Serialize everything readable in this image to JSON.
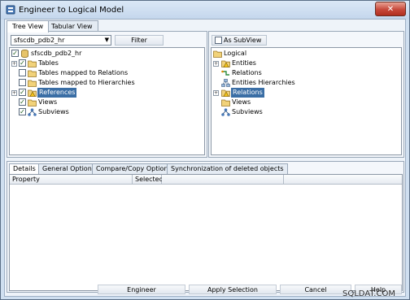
{
  "window": {
    "title": "Engineer to Logical Model",
    "close_glyph": "✕",
    "app_icon": "app-model-icon"
  },
  "top_tabs": [
    {
      "label": "Tree View",
      "active": true
    },
    {
      "label": "Tabular View",
      "active": false
    }
  ],
  "left_panel": {
    "combo_value": "sfscdb_pdb2_hr",
    "filter_button": "Filter",
    "tree": [
      {
        "label": "sfscdb_pdb2_hr",
        "checked": true,
        "icon": "database-icon",
        "expander": ""
      },
      {
        "label": "Tables",
        "checked": true,
        "icon": "folder-icon",
        "expander": "+"
      },
      {
        "label": "Tables mapped to Relations",
        "checked": false,
        "icon": "folder-icon",
        "expander": ""
      },
      {
        "label": "Tables mapped to Hierarchies",
        "checked": false,
        "icon": "folder-icon",
        "expander": ""
      },
      {
        "label": "References",
        "checked": true,
        "icon": "warning-folder-icon",
        "expander": "+",
        "selected": true
      },
      {
        "label": "Views",
        "checked": true,
        "icon": "folder-icon",
        "expander": ""
      },
      {
        "label": "Subviews",
        "checked": true,
        "icon": "subview-icon",
        "expander": ""
      }
    ]
  },
  "right_panel": {
    "subview_checkbox_label": "As SubView",
    "tree": [
      {
        "label": "Logical",
        "icon": "folder-icon",
        "expander": ""
      },
      {
        "label": "Entities",
        "icon": "warning-folder-icon",
        "expander": "+"
      },
      {
        "label": "Relations",
        "icon": "relation-icon",
        "expander": ""
      },
      {
        "label": "Entities Hierarchies",
        "icon": "hierarchy-icon",
        "expander": ""
      },
      {
        "label": "Relations",
        "icon": "warning-folder-icon",
        "expander": "+",
        "selected": true
      },
      {
        "label": "Views",
        "icon": "folder-icon",
        "expander": ""
      },
      {
        "label": "Subviews",
        "icon": "subview-icon",
        "expander": ""
      }
    ]
  },
  "bottom_tabs": [
    {
      "label": "Details",
      "active": true
    },
    {
      "label": "General Options",
      "active": false
    },
    {
      "label": "Compare/Copy Options",
      "active": false
    },
    {
      "label": "Synchronization of deleted objects",
      "active": false
    }
  ],
  "grid": {
    "columns": [
      "Property",
      "Selected",
      ""
    ]
  },
  "buttons": {
    "engineer": "Engineer",
    "apply": "Apply Selection",
    "cancel": "Cancel",
    "help": "Help"
  },
  "watermark": "SQLDAT.COM",
  "colors": {
    "selection": "#3a6ea5",
    "close_button": "#c7483a",
    "chrome": "#cfdff0"
  }
}
